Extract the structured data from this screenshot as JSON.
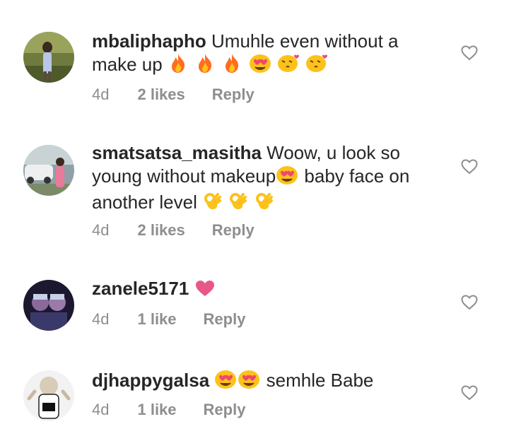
{
  "comments": [
    {
      "username": "mbaliphapho",
      "text": "Umuhle even without a make up",
      "emojis": [
        "fire-emoji",
        "fire-emoji",
        "fire-emoji",
        "heart-eyes-emoji",
        "kissing-heart-emoji",
        "kissing-heart-emoji"
      ],
      "time": "4d",
      "likes": "2 likes",
      "reply": "Reply"
    },
    {
      "username": "smatsatsa_masitha",
      "text_part1": "Woow, u look so young without makeup",
      "text_part2": "baby face on another level",
      "emojis_mid": [
        "heart-eyes-emoji"
      ],
      "emojis_end": [
        "ok-hand-emoji",
        "ok-hand-emoji",
        "ok-hand-emoji"
      ],
      "time": "4d",
      "likes": "2 likes",
      "reply": "Reply"
    },
    {
      "username": "zanele5171",
      "text": "",
      "emojis": [
        "pink-heart-emoji"
      ],
      "time": "4d",
      "likes": "1 like",
      "reply": "Reply"
    },
    {
      "username": "djhappygalsa",
      "text": "semhle Babe",
      "emojis": [
        "heart-eyes-emoji",
        "heart-eyes-emoji"
      ],
      "time": "4d",
      "likes": "1 like",
      "reply": "Reply"
    }
  ],
  "colors": {
    "text": "#262626",
    "meta": "#8e8e8e",
    "heart_outline": "#8e8e8e"
  }
}
